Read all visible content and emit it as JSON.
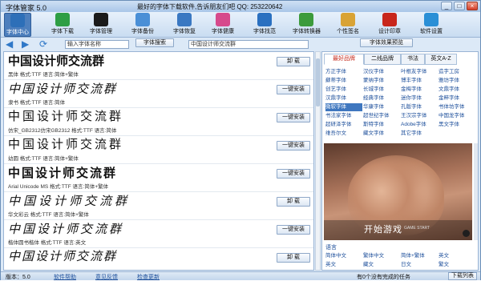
{
  "window": {
    "title": "字体管家 5.0",
    "ad_text": "最好的字体下载软件,告诉朋友们吧 QQ: 253220642",
    "buttons": [
      "_",
      "□",
      "×"
    ]
  },
  "toolbar": {
    "items": [
      {
        "label": "字体中心",
        "icon": "font-center-icon",
        "color": "#2d6fb8"
      },
      {
        "label": "字体下载",
        "icon": "download-icon",
        "color": "#2e9e44"
      },
      {
        "label": "字体管理",
        "icon": "font-manage-icon",
        "color": "#1b1b1b"
      },
      {
        "label": "字体备份",
        "icon": "backup-icon",
        "color": "#4a8fd6"
      },
      {
        "label": "字体恢复",
        "icon": "restore-icon",
        "color": "#3a78c2"
      },
      {
        "label": "字体健康",
        "icon": "health-icon",
        "color": "#d64a8c"
      },
      {
        "label": "字体找范",
        "icon": "search-icon",
        "color": "#2a70c0"
      },
      {
        "label": "字体转换器",
        "icon": "converter-icon",
        "color": "#3c9b3c"
      },
      {
        "label": "个性签名",
        "icon": "signature-icon",
        "color": "#d9a335"
      },
      {
        "label": "设计印章",
        "icon": "seal-icon",
        "color": "#c8261b"
      },
      {
        "label": "软件设置",
        "icon": "settings-icon",
        "color": "#2a8fd6"
      }
    ]
  },
  "nav": {
    "search_placeholder": "输入字体名称",
    "search_button": "字体搜索",
    "preview_text": "中国设计师交流群",
    "preview_button": "字体效果预览"
  },
  "font_rows": [
    {
      "sample": "中国设计师交流群",
      "meta": "黑体 格式:TTF 语言:简体+繁体",
      "action": "卸 载"
    },
    {
      "sample": "中国设计师交流群",
      "meta": "隶书 格式:TTF 语言:简体",
      "action": "一键安装"
    },
    {
      "sample": "中国设计师交流群",
      "meta": "仿宋_GB2312仿宋GB2312 格式:TTF 语言:简体",
      "action": "一键安装"
    },
    {
      "sample": "中国设计师交流群",
      "meta": "幼圆 格式:TTF 语言:简体+繁体",
      "action": "一键安装"
    },
    {
      "sample": "中国设计师交流群",
      "meta": "Arial Unicode MS 格式:TTF 语言:简体+繁体",
      "action": "一键安装"
    },
    {
      "sample": "中国设计师交流群",
      "meta": "华文彩云 格式:TTF 语言:简体+繁体",
      "action": "卸 载"
    },
    {
      "sample": "中国设计师交流群",
      "meta": "楷体圆书楷体 格式:TTF 语言:英文",
      "action": "一键安装"
    },
    {
      "sample": "中国设计师交流群",
      "meta": "",
      "action": "卸 载"
    }
  ],
  "right_panel": {
    "tabs": [
      "最好品牌",
      "二线品牌",
      "书法",
      "英文A-Z"
    ],
    "brand_rows": [
      [
        "方正字体",
        "汉仪字体",
        "叶根友字体",
        "造字工房"
      ],
      [
        "蘇蒂字体",
        "蒙纳字体",
        "博丰字体",
        "雅坊字体"
      ],
      [
        "创艺字体",
        "长城字体",
        "金梅字体",
        "文鼎字体"
      ],
      [
        "汉鼎字体",
        "经典字体",
        "迷你字体",
        "金粹字体"
      ],
      [
        "微软字体",
        "华康字体",
        "孔版字体",
        "书体坊字体"
      ],
      [
        "书法家字体",
        "超世纪字体",
        "王汉宗字体",
        "中国龙字体"
      ],
      [
        "超研泽字体",
        "斯特字体",
        "Adobe字体",
        "黑文字体"
      ],
      [
        "维吾尔文",
        "藏文字体",
        "其它字体",
        ""
      ]
    ],
    "highlight": "微软字体",
    "ad": {
      "cta": "开始游戏",
      "sub": "GAME START"
    },
    "language_title": "语言",
    "language_rows": [
      [
        "简体中文",
        "繁体中文",
        "简体+繁体",
        "英文"
      ],
      [
        "英文",
        "藏文",
        "日文",
        "繁文"
      ]
    ]
  },
  "status": {
    "version": "版本：5.0",
    "links": [
      "软件帮助",
      "意见反馈",
      "检查更新"
    ],
    "task": "有0个没有完成的任务",
    "download_button": "下载列表"
  }
}
